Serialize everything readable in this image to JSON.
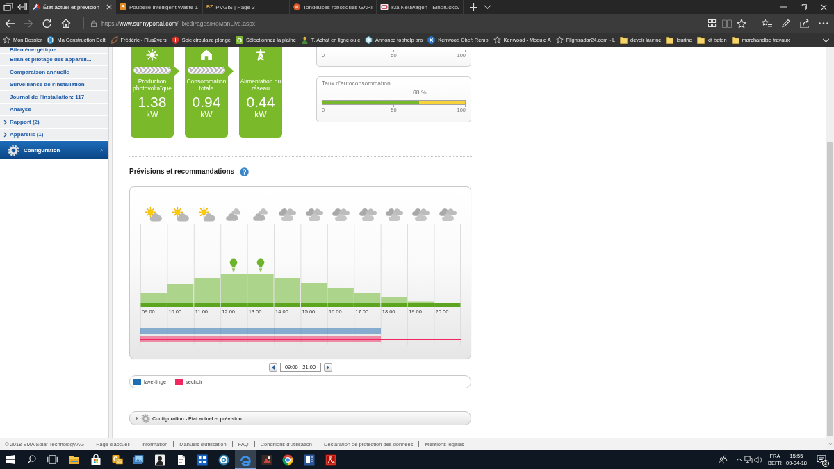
{
  "browser": {
    "tabs": [
      {
        "title": "État actuel et prévision",
        "favicon": {
          "kind": "triangle"
        },
        "selected": true
      },
      {
        "title": "Poubelle Intelligent Waste 1",
        "favicon": {
          "kind": "tile",
          "text": "B"
        },
        "selected": false
      },
      {
        "title": "PVGIS | Page 3",
        "favicon": {
          "kind": "letters",
          "text": "BZ"
        },
        "selected": false
      },
      {
        "title": "Tondeuses robotiques GARI",
        "favicon": {
          "kind": "ring"
        },
        "selected": false
      },
      {
        "title": "Kia Neuwagen - Eindrucksv",
        "favicon": {
          "kind": "emblem"
        },
        "selected": false
      }
    ],
    "nav_buttons": [
      {
        "kind": "back",
        "disabled": false
      },
      {
        "kind": "forward",
        "disabled": true
      },
      {
        "kind": "refresh",
        "disabled": false
      },
      {
        "kind": "home",
        "disabled": false
      }
    ],
    "address": {
      "scheme": "https://",
      "host": "www.sunnyportal.com",
      "path": "/FixedPages/HoManLive.aspx"
    },
    "toolbar_groups": [
      {
        "buttons": [
          {
            "kind": "squares",
            "disabled": false
          },
          {
            "kind": "book",
            "disabled": true
          },
          {
            "kind": "star",
            "disabled": false
          }
        ]
      },
      {
        "buttons": [
          {
            "kind": "star-list",
            "disabled": false
          },
          {
            "kind": "pen",
            "disabled": false
          },
          {
            "kind": "share",
            "disabled": false
          },
          {
            "kind": "more",
            "disabled": false
          }
        ]
      }
    ],
    "bookmarks": [
      {
        "label": "Mon Dossier",
        "kind": "star"
      },
      {
        "label": "Ma Construction Delt",
        "kind": "circle"
      },
      {
        "label": "Frédéric - Plus2vers",
        "kind": "leaf"
      },
      {
        "label": "Scie circulaire plonge",
        "kind": "shield"
      },
      {
        "label": "Sélectionnez la plaine",
        "kind": "tile"
      },
      {
        "label": "T. Achat en ligne ou c",
        "kind": "person"
      },
      {
        "label": "Annonce tophelp pro",
        "kind": "hexagon"
      },
      {
        "label": "Kenwood Chef: Remp",
        "kind": "x-circle"
      },
      {
        "label": "Kenwood - Module A",
        "kind": "star"
      },
      {
        "label": "Flightradar24.com - L",
        "kind": "star"
      },
      {
        "label": "devoir laurine",
        "kind": "folder"
      },
      {
        "label": "laurine",
        "kind": "folder"
      },
      {
        "label": "kit beton",
        "kind": "folder"
      },
      {
        "label": "marchandise travaux",
        "kind": "folder"
      }
    ]
  },
  "sidebar": {
    "links": [
      "Bilan énergétique",
      "Bilan et pilotage des appareil...",
      "Comparaison annuelle",
      "Surveillance de l’installation",
      "Journal de l’installation: 117",
      "Analyse"
    ],
    "groups": [
      {
        "label": "Rapport (2)",
        "expanded": false
      },
      {
        "label": "Appareils (1)",
        "expanded": false
      }
    ],
    "section": {
      "label": "Configuration"
    }
  },
  "power_flow": {
    "cards": [
      {
        "kind": "production",
        "label": "Production photovoltaïque",
        "value": "1.38",
        "unit": "kW",
        "flow": true
      },
      {
        "kind": "consumption",
        "label": "Consommation totale",
        "value": "0.94",
        "unit": "kW",
        "flow": true
      },
      {
        "kind": "grid",
        "label": "Alimentation du réseau",
        "value": "0.44",
        "unit": "kW",
        "flow": false
      }
    ]
  },
  "gauges": [
    {
      "ticks": [
        "0",
        "50",
        "100"
      ]
    },
    {
      "title": "Taux d’autoconsommation",
      "reading": "68 %",
      "level": 0.68,
      "ticks": [
        "0",
        "50",
        "100"
      ]
    }
  ],
  "forecast": {
    "title": "Prévisions et recommandations",
    "columns": [
      {
        "time": "09:00",
        "kind": "sun-cloud",
        "recommended": false
      },
      {
        "time": "10:00",
        "kind": "sun-cloud",
        "recommended": false
      },
      {
        "time": "11:00",
        "kind": "sun-cloud",
        "recommended": false
      },
      {
        "time": "12:00",
        "kind": "cloud",
        "recommended": true
      },
      {
        "time": "13:00",
        "kind": "cloud",
        "recommended": true
      },
      {
        "time": "14:00",
        "kind": "clouds",
        "recommended": false
      },
      {
        "time": "15:00",
        "kind": "clouds",
        "recommended": false
      },
      {
        "time": "16:00",
        "kind": "clouds",
        "recommended": false
      },
      {
        "time": "17:00",
        "kind": "clouds",
        "recommended": false
      },
      {
        "time": "18:00",
        "kind": "clouds",
        "recommended": false
      },
      {
        "time": "19:00",
        "kind": "clouds",
        "recommended": false
      },
      {
        "time": "20:00",
        "kind": "clouds",
        "recommended": false
      }
    ],
    "appliances": [
      {
        "name": "lave-linge",
        "color": "#1f6db3",
        "level": 0.75
      },
      {
        "name": "sechoir",
        "color": "#f0285f",
        "level": 0.75
      }
    ],
    "range": "09:00 - 21:00"
  },
  "collapsible_panels": [
    {
      "title": "Configuration - État actuel et prévision",
      "expanded": false
    }
  ],
  "footer": {
    "copyright": "© 2018 SMA Solar Technology AG",
    "links": [
      "Page d'accueil",
      "Information",
      "Manuels d'utilisation",
      "FAQ",
      "Conditions d'utilisation",
      "Déclaration de protection des données",
      "Mentions légales"
    ]
  },
  "taskbar": {
    "apps": [
      {
        "kind": "folder",
        "selected": false
      },
      {
        "kind": "bag",
        "selected": false
      },
      {
        "kind": "mail",
        "selected": false
      },
      {
        "kind": "photos",
        "selected": false
      },
      {
        "kind": "portrait",
        "selected": false
      },
      {
        "kind": "document",
        "selected": false
      },
      {
        "kind": "grid",
        "selected": false
      },
      {
        "kind": "ring",
        "selected": false
      },
      {
        "kind": "swirl",
        "selected": true
      },
      {
        "kind": "picture",
        "selected": false
      },
      {
        "kind": "segmented",
        "selected": false
      },
      {
        "kind": "doc-tile",
        "selected": false
      },
      {
        "kind": "curve-tile",
        "selected": false
      }
    ],
    "language": "FRA",
    "keyboard": "BEFR",
    "time": "15:55",
    "date": "09-04-18",
    "notifications": "2"
  }
}
